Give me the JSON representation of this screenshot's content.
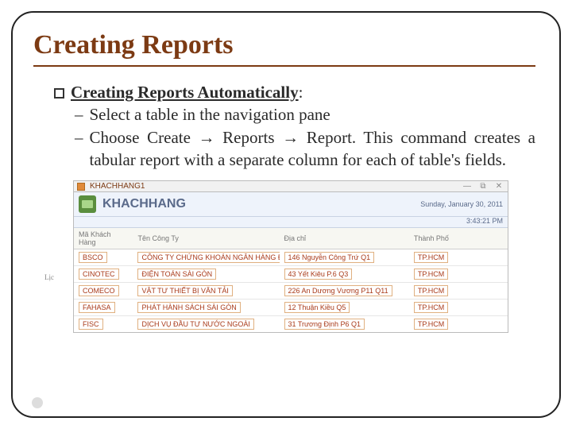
{
  "title": "Creating Reports",
  "bullet_main": "Creating Reports Automatically",
  "colon": ":",
  "sub1": "Select a table in the navigation pane",
  "sub2_pre": "Choose Create ",
  "sub2_mid": " Reports ",
  "sub2_post": " Report. This command creates a tabular report with a separate column for each of table's fields.",
  "arrow": "→",
  "dash": "–",
  "tab_name": "KHACHHANG1",
  "win": {
    "a": "—",
    "b": "⧉",
    "c": "✕"
  },
  "report_title": "KHACHHANG",
  "date_text": "Sunday, January 30, 2011",
  "time_text": "3:43:21 PM",
  "left_tiny": "Lịc",
  "headers": {
    "c1": "Mã Khách Hàng",
    "c2": "Tên Công Ty",
    "c3": "Địa chỉ",
    "c4": "Thành Phố"
  },
  "rows": [
    {
      "c1": "BSCO",
      "c2": "CÔNG TY CHỨNG KHOÁN NGÂN HÀNG ĐT&PTVN",
      "c3": "146 Nguyễn Công Trứ Q1",
      "c4": "TP.HCM"
    },
    {
      "c1": "CINOTEC",
      "c2": "ĐIỆN TOÁN SÀI GÒN",
      "c3": "43 Yết Kiêu P.6 Q3",
      "c4": "TP.HCM"
    },
    {
      "c1": "COMECO",
      "c2": "VẬT TƯ THIẾT BỊ VĂN TẢI",
      "c3": "226 An Dương Vương P11 Q11",
      "c4": "TP.HCM"
    },
    {
      "c1": "FAHASA",
      "c2": "PHÁT HÀNH SÁCH SÀI GÒN",
      "c3": "12 Thuận Kiều Q5",
      "c4": "TP.HCM"
    },
    {
      "c1": "FISC",
      "c2": "DỊCH VỤ ĐẦU TƯ NƯỚC NGOÀI",
      "c3": "31 Trương Định P6 Q1",
      "c4": "TP.HCM"
    }
  ]
}
